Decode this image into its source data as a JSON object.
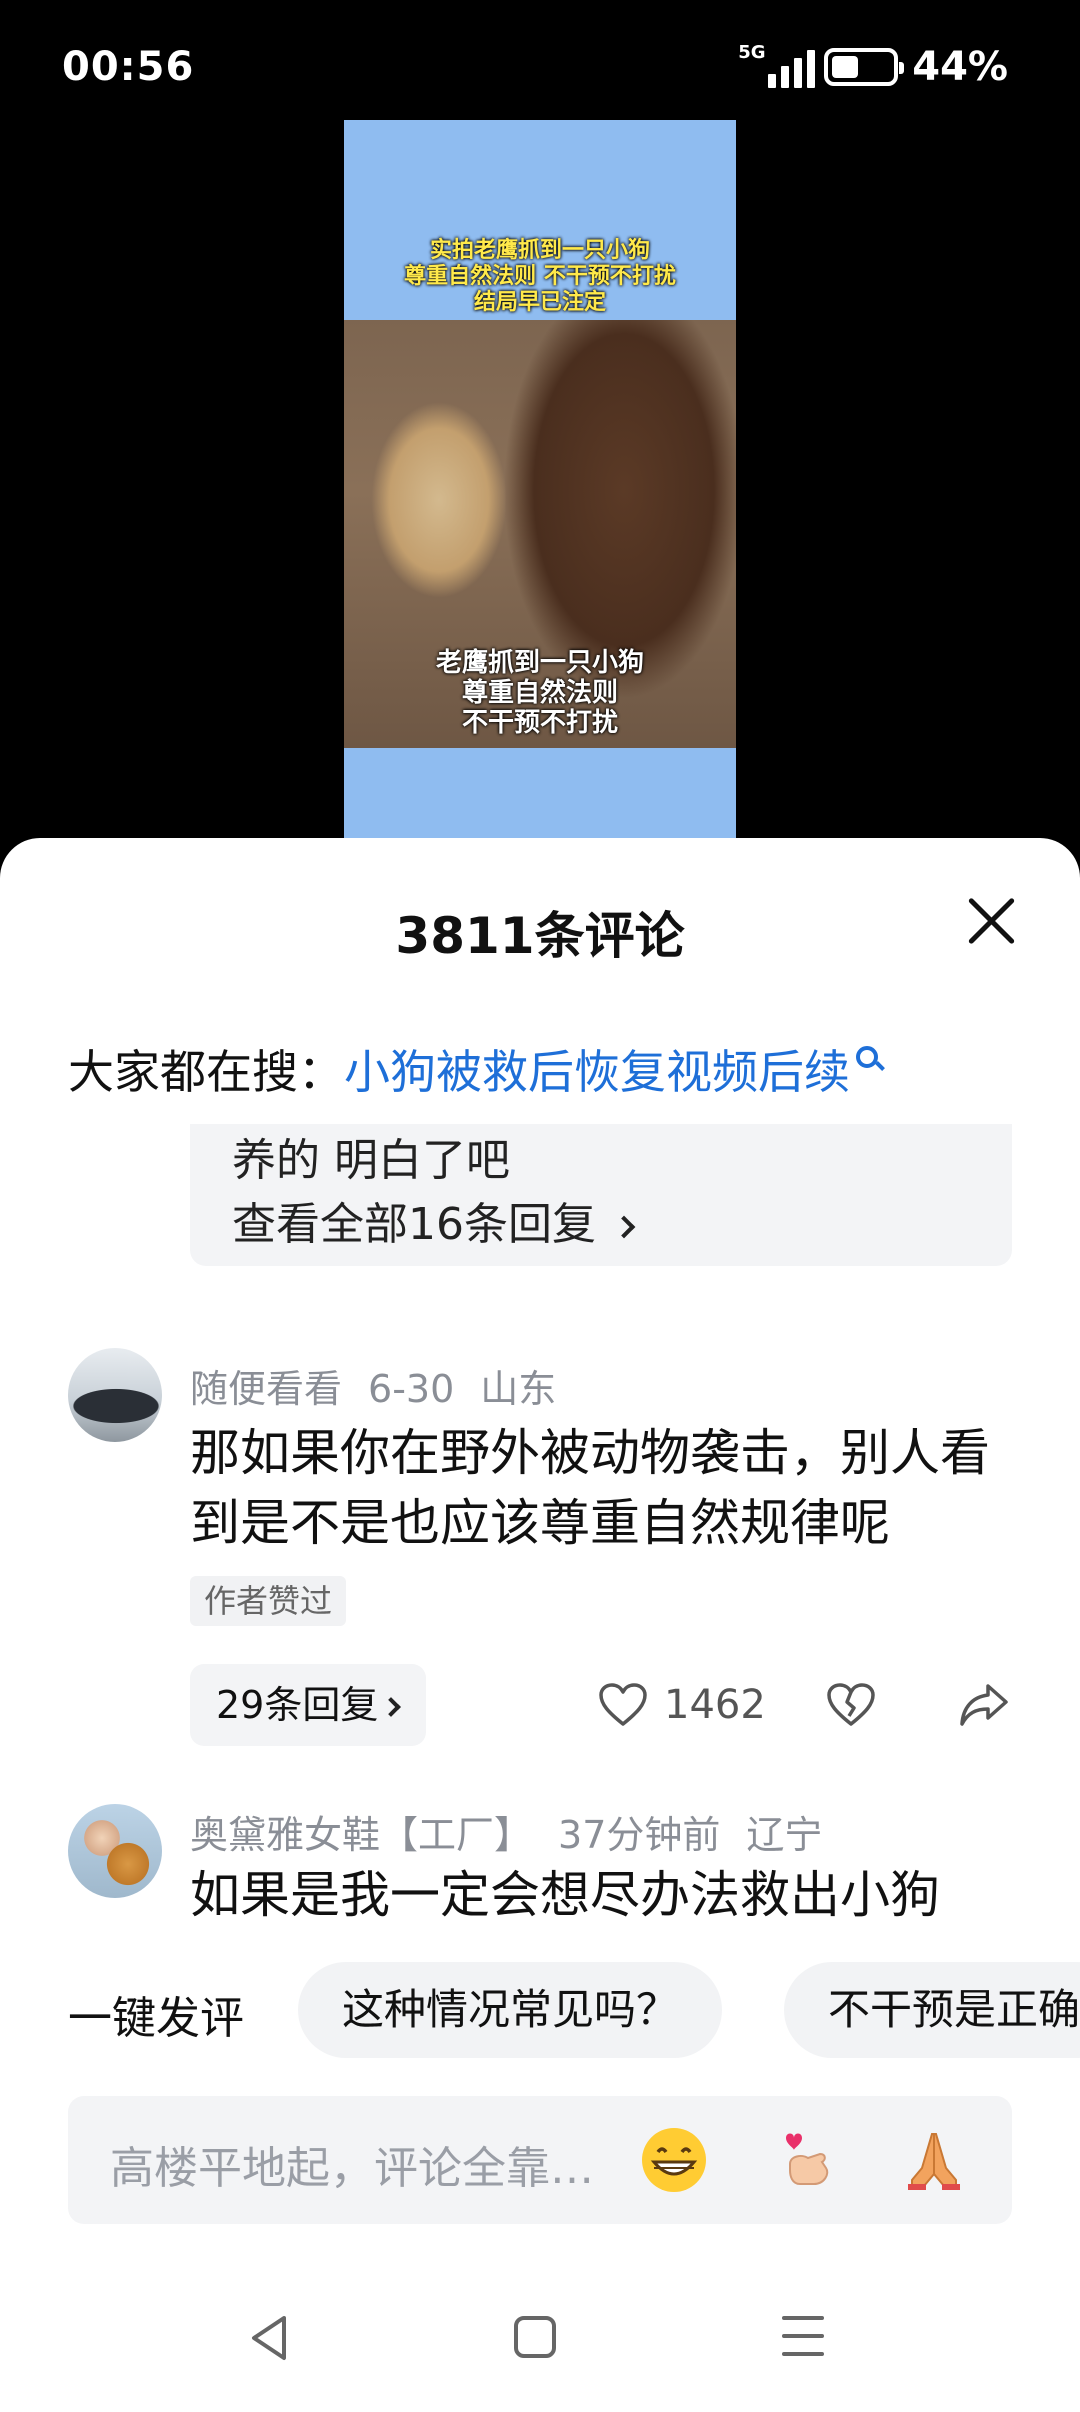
{
  "status_bar": {
    "time": "00:56",
    "network": "5G",
    "battery_pct": "44%",
    "battery_level": 0.44
  },
  "video": {
    "top_caption": [
      "实拍老鹰抓到一只小狗",
      "尊重自然法则 不干预不打扰",
      "结局早已注定"
    ],
    "bottom_caption": [
      "老鹰抓到一只小狗",
      "尊重自然法则",
      "不干预不打扰"
    ]
  },
  "sheet": {
    "title": "3811条评论",
    "search_label": "大家都在搜：",
    "search_link": "小狗被救后恢复视频后续"
  },
  "reply_thread": {
    "tail_text": "养的 明白了吧",
    "view_all": "查看全部16条回复"
  },
  "comments": [
    {
      "user": "随便看看",
      "date": "6-30",
      "location": "山东",
      "text": "那如果你在野外被动物袭击，别人看到是不是也应该尊重自然规律呢",
      "author_liked": "作者赞过",
      "replies": "29条回复",
      "likes": "1462"
    },
    {
      "user": "奥黛雅女鞋【工厂】",
      "date": "37分钟前",
      "location": "辽宁",
      "text": "如果是我一定会想尽办法救出小狗"
    }
  ],
  "quick_reply": {
    "label": "一键发评",
    "chips": [
      "这种情况常见吗？",
      "不干预是正确"
    ]
  },
  "input": {
    "placeholder": "高楼平地起，评论全靠…",
    "emojis": [
      "grinning-emoji",
      "finger-heart-emoji",
      "praying-hands-emoji"
    ]
  },
  "navbar": {
    "icons": [
      "back-icon",
      "home-icon",
      "menu-icon"
    ]
  }
}
